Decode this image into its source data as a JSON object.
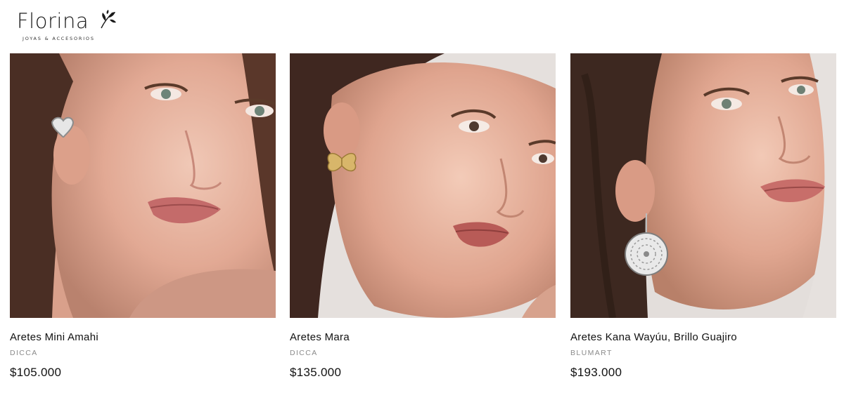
{
  "header": {
    "logo_word": "Florina",
    "logo_tagline": "JOYAS & ACCESORIOS"
  },
  "products": [
    {
      "name": "Aretes Mini Amahi",
      "brand": "DICCA",
      "price": "$105.000"
    },
    {
      "name": "Aretes Mara",
      "brand": "DICCA",
      "price": "$135.000"
    },
    {
      "name": "Aretes Kana Wayúu, Brillo Guajiro",
      "brand": "BLUMART",
      "price": "$193.000"
    }
  ],
  "colors": {
    "text": "#111111",
    "brand_text": "#8a8a8a",
    "background": "#ffffff"
  }
}
